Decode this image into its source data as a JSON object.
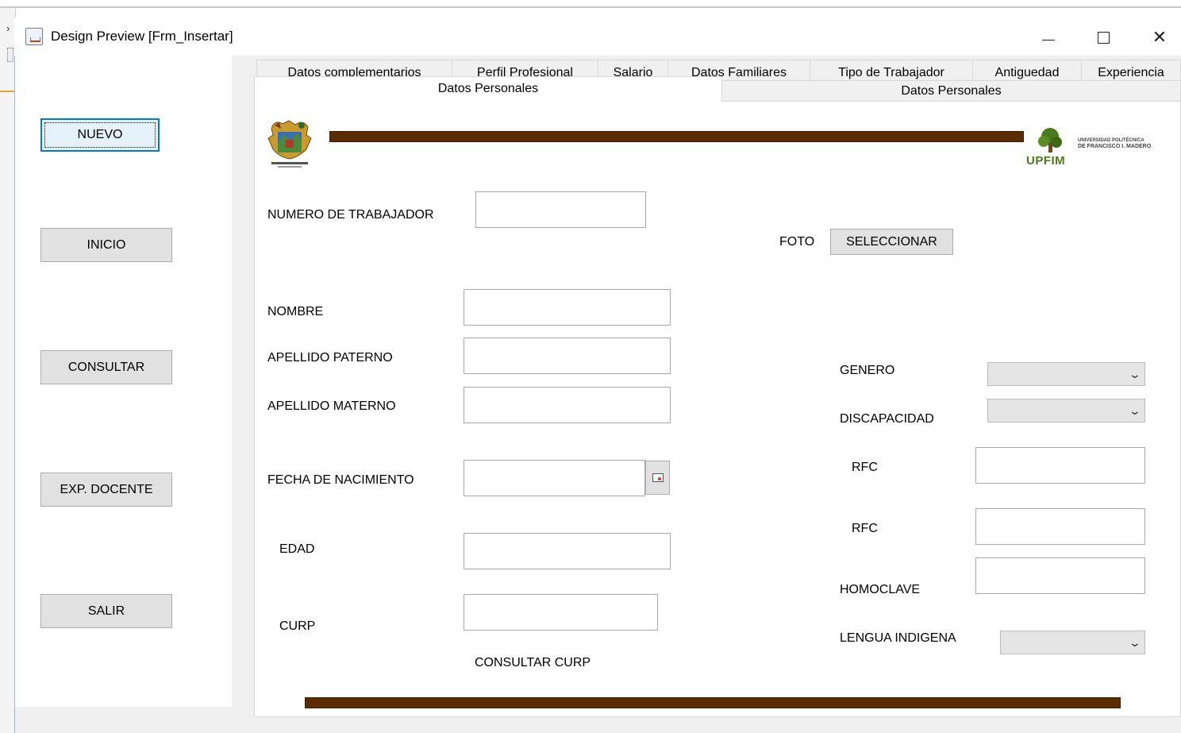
{
  "window": {
    "title": "Design Preview [Frm_Insertar]",
    "controls": {
      "minimize": "minimize",
      "maximize": "maximize",
      "close": "✕"
    }
  },
  "sidebar": {
    "buttons": [
      {
        "label": "NUEVO",
        "focused": true
      },
      {
        "label": "INICIO"
      },
      {
        "label": "CONSULTAR"
      },
      {
        "label": "EXP. DOCENTE"
      },
      {
        "label": "SALIR"
      }
    ]
  },
  "tabs": {
    "row1": [
      "Datos complementarios",
      "Perfil Profesional",
      "Salario",
      "Datos Familiares",
      "Tipo de Trabajador",
      "Antiguedad",
      "Experiencia"
    ],
    "row2": [
      "Datos Personales",
      "Datos Personales"
    ],
    "active_index": 0
  },
  "logos": {
    "upfim_text": "UPFIM",
    "upfim_subtitle_1": "UNIVERSIDAD POLITÉCNICA",
    "upfim_subtitle_2": "DE FRANCISCO I. MADERO",
    "upfim_color": "#4a7a1c"
  },
  "form": {
    "numero_trabajador_label": "NUMERO DE TRABAJADOR",
    "numero_trabajador_value": "",
    "foto_label": "FOTO",
    "seleccionar_button": "SELECCIONAR",
    "nombre_label": "NOMBRE",
    "nombre_value": "",
    "apellido_paterno_label": "APELLIDO PATERNO",
    "apellido_paterno_value": "",
    "apellido_materno_label": "APELLIDO MATERNO",
    "apellido_materno_value": "",
    "fecha_nacimiento_label": "FECHA DE NACIMIENTO",
    "fecha_nacimiento_value": "",
    "edad_label": "EDAD",
    "edad_value": "",
    "curp_label": "CURP",
    "curp_value": "",
    "consultar_curp_label": "CONSULTAR CURP",
    "genero_label": "GENERO",
    "genero_value": "",
    "discapacidad_label": "DISCAPACIDAD",
    "discapacidad_value": "",
    "rfc_label_1": "RFC",
    "rfc_value_1": "",
    "rfc_label_2": "RFC",
    "rfc_value_2": "",
    "homoclave_label": "HOMOCLAVE",
    "homoclave_value": "",
    "lengua_indigena_label": "LENGUA INDIGENA",
    "lengua_indigena_value": ""
  },
  "colors": {
    "stripe": "#5c2c00",
    "focus_border": "#0078d7",
    "button_face": "#e1e1e1"
  }
}
